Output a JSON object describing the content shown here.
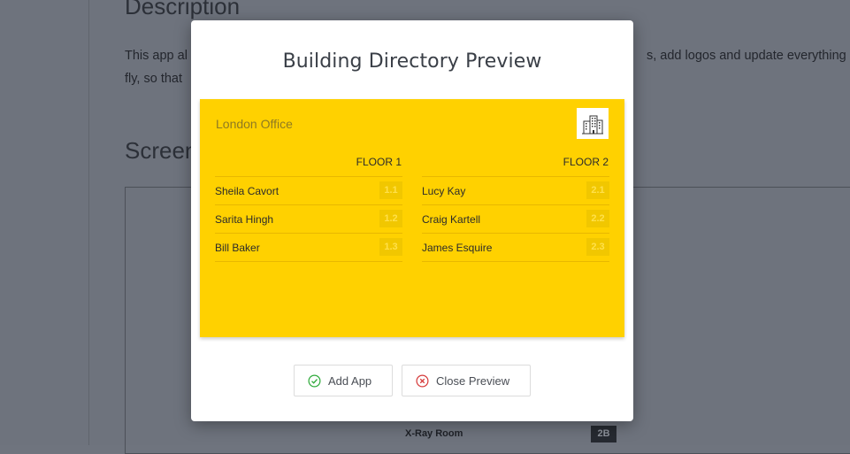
{
  "background": {
    "heading": "Description",
    "para_line1_start": "This app al",
    "para_line1_end": "s, add logos and update everything",
    "para_line2_start": "fly, so that",
    "screenshots_heading": "Screen",
    "bg_room_label": "X-Ray Room",
    "bg_room_number": "2B"
  },
  "modal": {
    "title": "Building Directory Preview",
    "preview": {
      "background_color": "#ffd100",
      "office_name": "London Office",
      "logo_icon": "building-icon",
      "floors": [
        {
          "title": "FLOOR 1",
          "rows": [
            {
              "name": "Sheila Cavort",
              "room": "1.1"
            },
            {
              "name": "Sarita Hingh",
              "room": "1.2"
            },
            {
              "name": "Bill Baker",
              "room": "1.3"
            }
          ]
        },
        {
          "title": "FLOOR 2",
          "rows": [
            {
              "name": "Lucy Kay",
              "room": "2.1"
            },
            {
              "name": "Craig Kartell",
              "room": "2.2"
            },
            {
              "name": "James Esquire",
              "room": "2.3"
            }
          ]
        }
      ]
    },
    "buttons": {
      "add_label": "Add App",
      "add_icon": "check-circle-icon",
      "close_label": "Close Preview",
      "close_icon": "x-circle-icon"
    }
  }
}
